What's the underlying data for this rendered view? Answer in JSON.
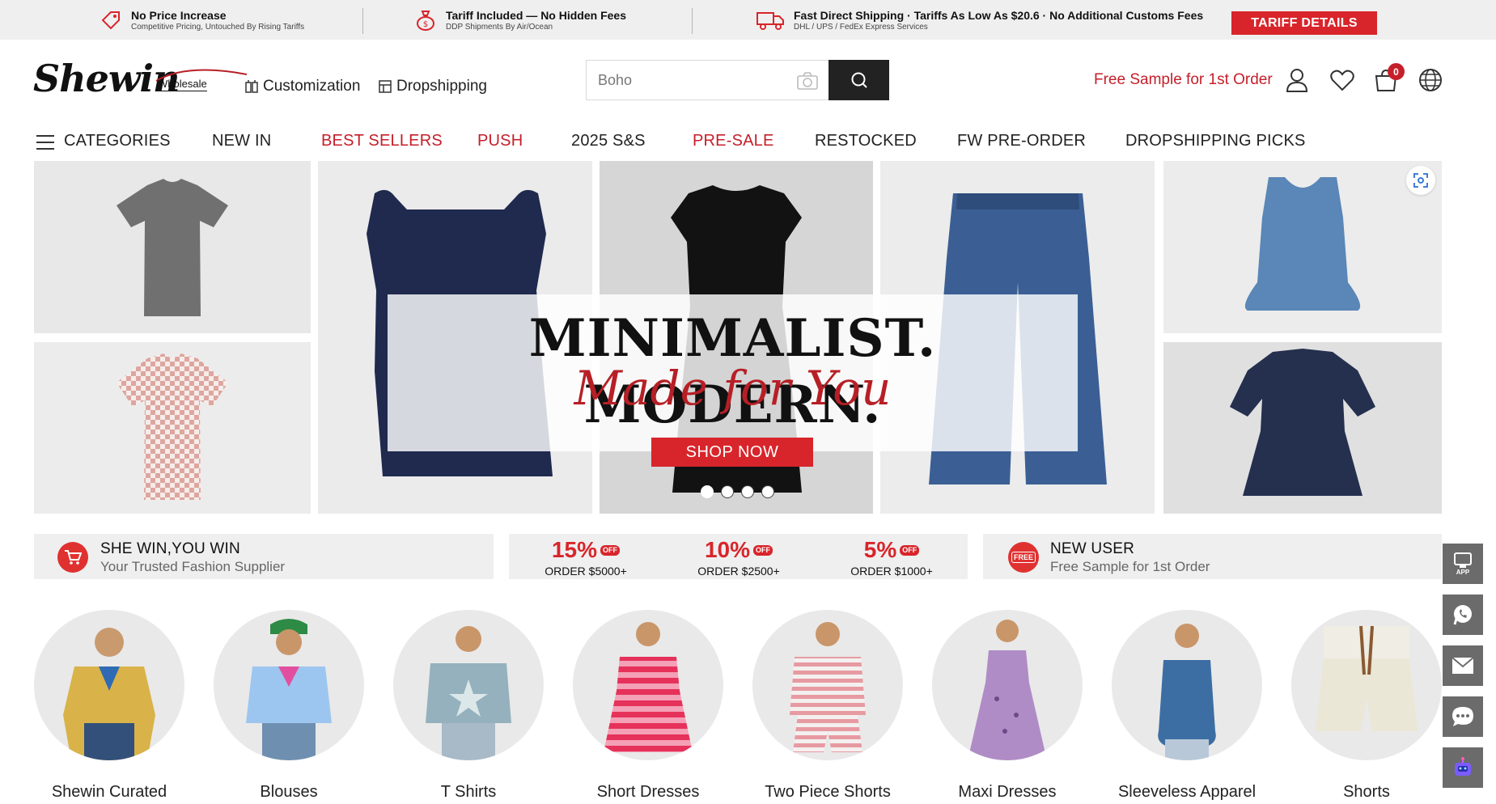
{
  "promo_bar": {
    "items": [
      {
        "title": "No Price Increase",
        "subtitle": "Competitive Pricing, Untouched By Rising Tariffs",
        "icon": "price-tag-icon"
      },
      {
        "title": "Tariff Included — No Hidden Fees",
        "subtitle": "DDP Shipments By Air/Ocean",
        "icon": "money-bag-icon"
      },
      {
        "title": "Fast Direct Shipping · Tariffs As Low As $20.6 · No Additional Customs Fees",
        "subtitle": "DHL / UPS / FedEx Express Services",
        "icon": "truck-icon"
      }
    ],
    "cta": "TARIFF DETAILS"
  },
  "header": {
    "logo": "Shewin",
    "logo_sub": "Wholesale",
    "links": [
      "Customization",
      "Dropshipping"
    ],
    "search_placeholder": "Boho",
    "free_sample": "Free Sample for 1st Order",
    "cart_count": "0"
  },
  "nav": {
    "categories": "CATEGORIES",
    "items": [
      "NEW IN",
      "BEST SELLERS",
      "PUSH",
      "2025 S&S",
      "PRE-SALE",
      "RESTOCKED",
      "FW PRE-ORDER",
      "DROPSHIPPING PICKS"
    ]
  },
  "banner": {
    "headline": "MINIMALIST. MODERN.",
    "script": "Made for You",
    "cta": "SHOP NOW",
    "slide_count": 4,
    "active_slide": 1
  },
  "benefits": {
    "left": {
      "title": "SHE WIN,YOU WIN",
      "subtitle": "Your Trusted Fashion Supplier"
    },
    "discounts": [
      {
        "pct": "15%",
        "off": "OFF",
        "order": "ORDER $5000+"
      },
      {
        "pct": "10%",
        "off": "OFF",
        "order": "ORDER $2500+"
      },
      {
        "pct": "5%",
        "off": "OFF",
        "order": "ORDER $1000+"
      }
    ],
    "right": {
      "title": "NEW USER",
      "subtitle": "Free Sample for 1st Order",
      "badge": "FREE"
    }
  },
  "categories": [
    "Shewin Curated",
    "Blouses",
    "T Shirts",
    "Short Dresses",
    "Two Piece Shorts",
    "Maxi Dresses",
    "Sleeveless Apparel",
    "Shorts"
  ],
  "float_buttons": [
    "app-icon",
    "whatsapp-icon",
    "email-icon",
    "chat-icon",
    "bot-icon"
  ],
  "float_app_label": "APP",
  "colors": {
    "accent": "#d8252b",
    "dark": "#222222",
    "nav_red": "#c51f2a"
  }
}
